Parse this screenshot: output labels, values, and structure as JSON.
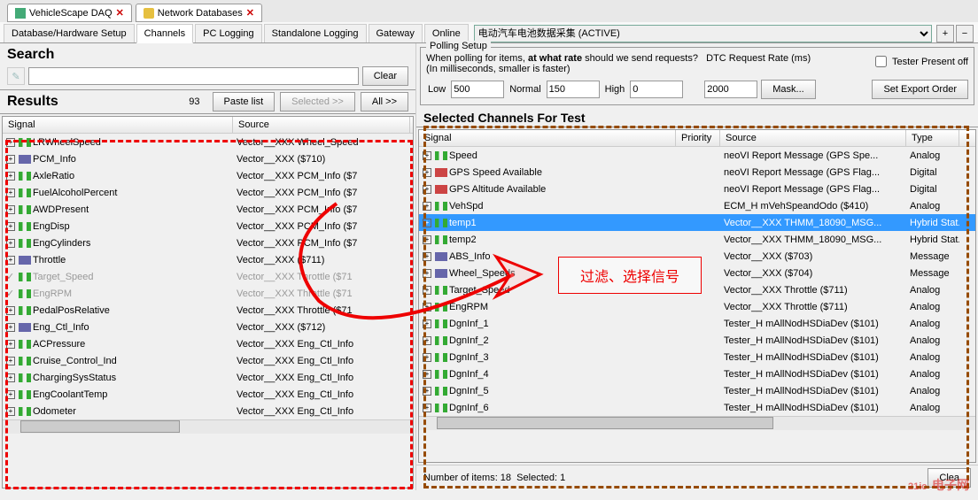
{
  "windowTabs": [
    {
      "icon": "app",
      "label": "VehicleScape DAQ"
    },
    {
      "icon": "db",
      "label": "Network Databases"
    }
  ],
  "mainTabs": {
    "items": [
      "Database/Hardware Setup",
      "Channels",
      "PC Logging",
      "Standalone Logging",
      "Gateway",
      "Online"
    ],
    "activeIndex": 1,
    "profileDropdown": "电动汽车电池数据采集 (ACTIVE)",
    "plusBtn": "+",
    "minusBtn": "−"
  },
  "search": {
    "title": "Search",
    "value": "",
    "clearBtn": "Clear"
  },
  "results": {
    "title": "Results",
    "count": "93",
    "pasteBtn": "Paste list",
    "selectedBtn": "Selected >>",
    "allBtn": "All >>"
  },
  "leftTable": {
    "headers": {
      "signal": "Signal",
      "source": "Source"
    },
    "colWidths": {
      "signal": 260,
      "source": 200
    },
    "rows": [
      {
        "signal": "LRWheelSpeed",
        "source": "Vector__XXX Wheel_Speed",
        "icon": "analog",
        "expand": true
      },
      {
        "signal": "PCM_Info",
        "source": "Vector__XXX ($710)",
        "icon": "message",
        "expand": true
      },
      {
        "signal": "AxleRatio",
        "source": "Vector__XXX PCM_Info ($7",
        "icon": "analog",
        "expand": true
      },
      {
        "signal": "FuelAlcoholPercent",
        "source": "Vector__XXX PCM_Info ($7",
        "icon": "analog",
        "expand": true
      },
      {
        "signal": "AWDPresent",
        "source": "Vector__XXX PCM_Info ($7",
        "icon": "analog",
        "expand": true
      },
      {
        "signal": "EngDisp",
        "source": "Vector__XXX PCM_Info ($7",
        "icon": "analog",
        "expand": true
      },
      {
        "signal": "EngCylinders",
        "source": "Vector__XXX PCM_Info ($7",
        "icon": "analog",
        "expand": true
      },
      {
        "signal": "Throttle",
        "source": "Vector__XXX ($711)",
        "icon": "message",
        "expand": true
      },
      {
        "signal": "Target_Speed",
        "source": "Vector__XXX Throttle ($71",
        "icon": "analog",
        "expand": null,
        "disabled": true
      },
      {
        "signal": "EngRPM",
        "source": "Vector__XXX Throttle ($71",
        "icon": "analog",
        "expand": null,
        "disabled": true
      },
      {
        "signal": "PedalPosRelative",
        "source": "Vector__XXX Throttle ($71",
        "icon": "analog",
        "expand": true
      },
      {
        "signal": "Eng_Ctl_Info",
        "source": "Vector__XXX ($712)",
        "icon": "message",
        "expand": true
      },
      {
        "signal": "ACPressure",
        "source": "Vector__XXX Eng_Ctl_Info",
        "icon": "analog",
        "expand": true
      },
      {
        "signal": "Cruise_Control_Ind",
        "source": "Vector__XXX Eng_Ctl_Info",
        "icon": "analog",
        "expand": true
      },
      {
        "signal": "ChargingSysStatus",
        "source": "Vector__XXX Eng_Ctl_Info",
        "icon": "analog",
        "expand": true
      },
      {
        "signal": "EngCoolantTemp",
        "source": "Vector__XXX Eng_Ctl_Info",
        "icon": "analog",
        "expand": true
      },
      {
        "signal": "Odometer",
        "source": "Vector__XXX Eng_Ctl_Info",
        "icon": "analog",
        "expand": true
      }
    ]
  },
  "polling": {
    "legend": "Polling Setup",
    "text1": "When polling for items,",
    "textBold": "at what rate",
    "text2": "should we send requests?",
    "text3": "DTC Request Rate (ms)",
    "text4": "(In milliseconds, smaller is faster)",
    "lowLabel": "Low",
    "lowVal": "500",
    "normalLabel": "Normal",
    "normalVal": "150",
    "highLabel": "High",
    "highVal": "0",
    "dtcVal": "2000",
    "maskBtn": "Mask...",
    "testerLabel": "Tester Present off",
    "exportBtn": "Set Export Order"
  },
  "selected": {
    "title": "Selected Channels For Test",
    "headers": {
      "signal": "Signal",
      "priority": "Priority",
      "source": "Source",
      "type": "Type"
    },
    "colWidths": {
      "signal": 290,
      "priority": 50,
      "source": 210,
      "type": 60
    },
    "rows": [
      {
        "signal": "Speed",
        "priority": "",
        "source": "neoVI Report Message (GPS Spe...",
        "type": "Analog",
        "icon": "analog",
        "expand": true
      },
      {
        "signal": "GPS Speed Available",
        "priority": "",
        "source": "neoVI Report Message (GPS Flag...",
        "type": "Digital",
        "icon": "digital",
        "expand": true
      },
      {
        "signal": "GPS Altitude Available",
        "priority": "",
        "source": "neoVI Report Message (GPS Flag...",
        "type": "Digital",
        "icon": "digital",
        "expand": true
      },
      {
        "signal": "VehSpd",
        "priority": "",
        "source": "ECM_H mVehSpeandOdo ($410)",
        "type": "Analog",
        "icon": "analog",
        "expand": true
      },
      {
        "signal": "temp1",
        "priority": "",
        "source": "Vector__XXX THMM_18090_MSG...",
        "type": "Hybrid Stat.",
        "icon": "analog",
        "expand": true,
        "selected": true
      },
      {
        "signal": "temp2",
        "priority": "",
        "source": "Vector__XXX THMM_18090_MSG...",
        "type": "Hybrid Stat.",
        "icon": "analog",
        "expand": true
      },
      {
        "signal": "ABS_Info",
        "priority": "",
        "source": "Vector__XXX ($703)",
        "type": "Message",
        "icon": "message",
        "expand": true
      },
      {
        "signal": "Wheel_Speeds",
        "priority": "",
        "source": "Vector__XXX ($704)",
        "type": "Message",
        "icon": "message",
        "expand": true
      },
      {
        "signal": "Target_Speed",
        "priority": "",
        "source": "Vector__XXX Throttle ($711)",
        "type": "Analog",
        "icon": "analog",
        "expand": true
      },
      {
        "signal": "EngRPM",
        "priority": "",
        "source": "Vector__XXX Throttle ($711)",
        "type": "Analog",
        "icon": "analog",
        "expand": true
      },
      {
        "signal": "DgnInf_1",
        "priority": "",
        "source": "Tester_H mAllNodHSDiaDev ($101)",
        "type": "Analog",
        "icon": "analog",
        "expand": true
      },
      {
        "signal": "DgnInf_2",
        "priority": "",
        "source": "Tester_H mAllNodHSDiaDev ($101)",
        "type": "Analog",
        "icon": "analog",
        "expand": true
      },
      {
        "signal": "DgnInf_3",
        "priority": "",
        "source": "Tester_H mAllNodHSDiaDev ($101)",
        "type": "Analog",
        "icon": "analog",
        "expand": true
      },
      {
        "signal": "DgnInf_4",
        "priority": "",
        "source": "Tester_H mAllNodHSDiaDev ($101)",
        "type": "Analog",
        "icon": "analog",
        "expand": true
      },
      {
        "signal": "DgnInf_5",
        "priority": "",
        "source": "Tester_H mAllNodHSDiaDev ($101)",
        "type": "Analog",
        "icon": "analog",
        "expand": true
      },
      {
        "signal": "DgnInf_6",
        "priority": "",
        "source": "Tester_H mAllNodHSDiaDev ($101)",
        "type": "Analog",
        "icon": "analog",
        "expand": true
      }
    ],
    "statusItems": "Number of items: 18",
    "statusSelected": "Selected: 1",
    "cleBtn": "Clea"
  },
  "overlay": {
    "label": "过滤、选择信号"
  },
  "watermark": {
    "main": "21ic",
    "sub": "电子网"
  }
}
